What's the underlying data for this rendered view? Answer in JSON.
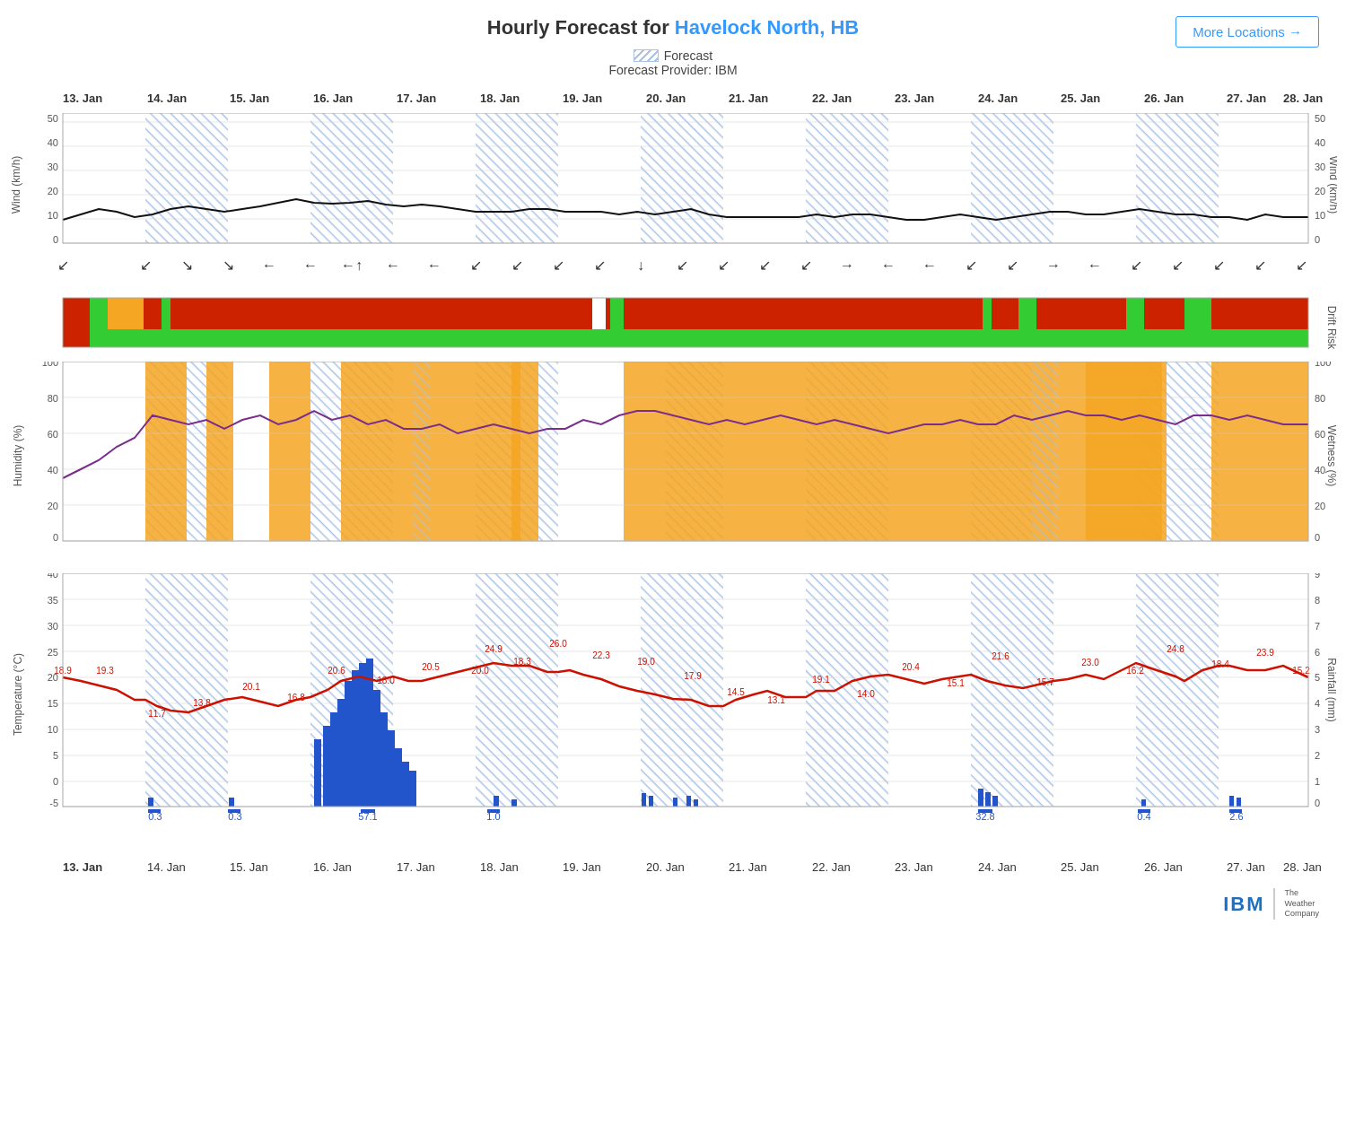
{
  "header": {
    "title_static": "Hourly Forecast for ",
    "location": "Havelock North, HB",
    "more_locations": "More Locations →"
  },
  "legend": {
    "forecast_label": "Forecast",
    "provider_label": "Forecast Provider: IBM"
  },
  "date_axis": [
    "13. Jan",
    "14. Jan",
    "15. Jan",
    "16. Jan",
    "17. Jan",
    "18. Jan",
    "19. Jan",
    "20. Jan",
    "21. Jan",
    "22. Jan",
    "23. Jan",
    "24. Jan",
    "25. Jan",
    "26. Jan",
    "27. Jan",
    "28. Jan"
  ],
  "wind_chart": {
    "y_label_left": "Wind (km/h)",
    "y_label_right": "Wind (km/h)",
    "y_ticks": [
      0,
      10,
      20,
      30,
      40,
      50
    ],
    "title": "Wind"
  },
  "drift_chart": {
    "y_label_right": "Drift Risk",
    "title": "Drift Risk"
  },
  "humidity_chart": {
    "y_label_left": "Humidity (%)",
    "y_label_right": "Wetness (%)",
    "y_ticks": [
      0,
      20,
      40,
      60,
      80,
      100
    ],
    "title": "Humidity/Wetness"
  },
  "temp_chart": {
    "y_label_left": "Temperature (°C)",
    "y_label_right": "Rainfall (mm)",
    "y_ticks_left": [
      -5,
      0,
      5,
      10,
      15,
      20,
      25,
      30,
      35,
      40
    ],
    "y_ticks_right": [
      0,
      1,
      2,
      3,
      4,
      5,
      6,
      7,
      8,
      9
    ],
    "temp_peaks": [
      18.9,
      19.3,
      11.7,
      13.8,
      20.1,
      16.8,
      20.6,
      18.0,
      20.5,
      20.0,
      18.3,
      24.9,
      26.0,
      22.3,
      19.0,
      17.9,
      14.5,
      13.1,
      19.1,
      14.0,
      20.4,
      15.1,
      21.6,
      15.7,
      23.0,
      16.2,
      24.8,
      18.4,
      23.9,
      15.2
    ],
    "rainfall_labels": [
      "0.3",
      "0.3",
      "57.1",
      "1.0",
      "32.8",
      "0.4",
      "2.6"
    ],
    "title": "Temperature/Rainfall"
  },
  "colors": {
    "accent_blue": "#3399ff",
    "hatch_blue": "#aac4e8",
    "red": "#cc2200",
    "orange": "#f5a623",
    "green": "#33cc33",
    "purple": "#7b2d8b",
    "dark_red": "#cc1100",
    "blue_bar": "#2255cc"
  }
}
